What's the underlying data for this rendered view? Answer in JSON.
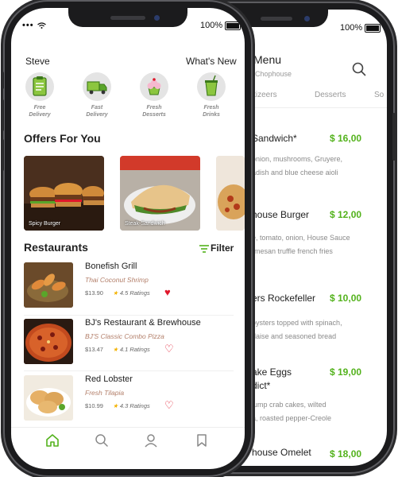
{
  "status": {
    "time": "•••",
    "battery": "100%"
  },
  "back": {
    "title": "Menu",
    "subtitle": "Chophouse",
    "tabs": [
      "petizeers",
      "Desserts",
      "So"
    ],
    "items": [
      {
        "name": "Sandwich*",
        "price": "$ 16,00",
        "desc1": "onion, mushrooms, Gruyere,",
        "desc2": "adish and blue cheese aioli"
      },
      {
        "name": "house Burger",
        "price": "$ 12,00",
        "desc1": "e, tomato, onion, House Sauce",
        "desc2": "rmesan truffle french fries"
      },
      {
        "name": "ers Rockefeller",
        "price": "$ 10,00",
        "desc1": "oysters topped with spinach,",
        "desc2": "daise and seasoned bread"
      },
      {
        "name": "ake Eggs",
        "name2": "dict*",
        "price": "$ 19,00",
        "desc1": "lump crab cakes, wilted",
        "desc2": "a, roasted pepper-Creole"
      },
      {
        "name": "house Omelet",
        "price": "$ 18,00"
      }
    ]
  },
  "front": {
    "user": "Steve",
    "whats_new": "What's New",
    "categories": [
      {
        "label1": "Free",
        "label2": "Delivery",
        "icon": "clipboard-icon"
      },
      {
        "label1": "Fast",
        "label2": "Delivery",
        "icon": "truck-icon"
      },
      {
        "label1": "Fresh",
        "label2": "Desserts",
        "icon": "cupcake-icon"
      },
      {
        "label1": "Fresh",
        "label2": "Drinks",
        "icon": "drink-icon"
      }
    ],
    "offers_title": "Offers For You",
    "offers": [
      {
        "name": "Spicy Burger"
      },
      {
        "name": "Steak-Sandwich"
      }
    ],
    "restaurants_title": "Restaurants",
    "filter_label": "Filter",
    "restaurants": [
      {
        "name": "Bonefish Grill",
        "dish": "Thai Coconut Shrimp",
        "price": "$13.90",
        "rating": "4.5 Ratings",
        "favorite": true
      },
      {
        "name": "BJ's Restaurant & Brewhouse",
        "dish": "BJ'S Classic Combo Pizza",
        "price": "$13.47",
        "rating": "4.1 Ratings",
        "favorite": false
      },
      {
        "name": "Red Lobster",
        "dish": "Fresh Tilapia",
        "price": "$10.99",
        "rating": "4.3 Ratings",
        "favorite": false
      }
    ],
    "tabbar": [
      "home-icon",
      "search-icon",
      "profile-icon",
      "bookmark-icon"
    ]
  },
  "colors": {
    "accent": "#53b21c",
    "heart": "#e0172b",
    "phone": "#1b1b1d"
  }
}
